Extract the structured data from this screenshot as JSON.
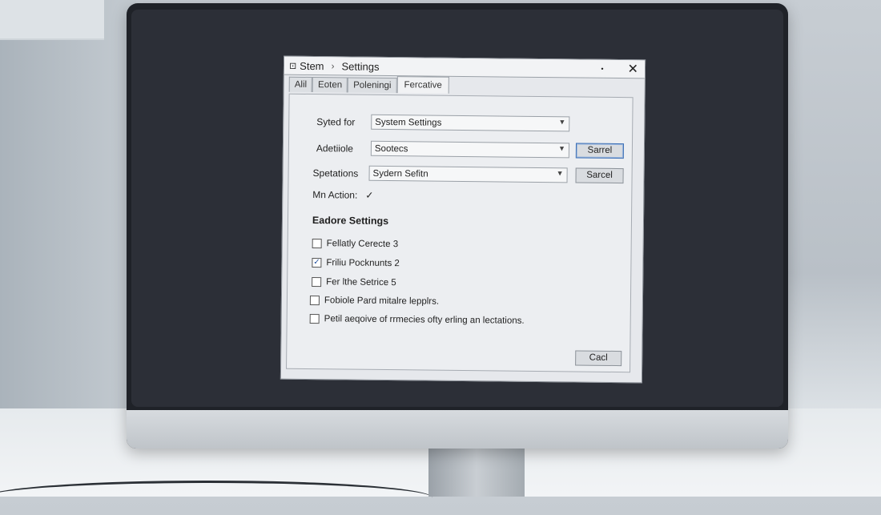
{
  "dialog": {
    "title_part1": "Stem",
    "title_separator": "›",
    "title_part2": "Settings",
    "app_icon": "⊡",
    "minimize_icon": "•",
    "close_icon": "✕"
  },
  "tabs": [
    {
      "label": "Alil"
    },
    {
      "label": "Eoten"
    },
    {
      "label": "Poleningi"
    },
    {
      "label": "Fercative",
      "active": true
    }
  ],
  "form": {
    "rows": [
      {
        "label": "Syted for",
        "value": "System Settings"
      },
      {
        "label": "Adetiiole",
        "value": "Sootecs",
        "button": "Sarrel"
      },
      {
        "label": "Spetations",
        "value": "Sydern Sefitn",
        "button": "Sarcel"
      }
    ],
    "action_label": "Mn Action:",
    "action_check": "✓"
  },
  "section_heading": "Eadore Settings",
  "checkboxes": [
    {
      "label": "Fellatly Cerecte 3",
      "checked": false
    },
    {
      "label": "Friliu Pocknunts 2",
      "checked": true
    },
    {
      "label": "Fer lthe Setrice 5",
      "checked": false
    },
    {
      "label": "Fobiole Pard mitalre lepplrs.",
      "checked": false
    },
    {
      "label": "Petil aeqoive of rrmecies ofty erling an lectations.",
      "checked": false
    }
  ],
  "footer": {
    "cancel_label": "Cacl"
  },
  "icons": {
    "dropdown": "chevron-down-icon",
    "check": "checkmark-icon",
    "close": "close-icon"
  }
}
